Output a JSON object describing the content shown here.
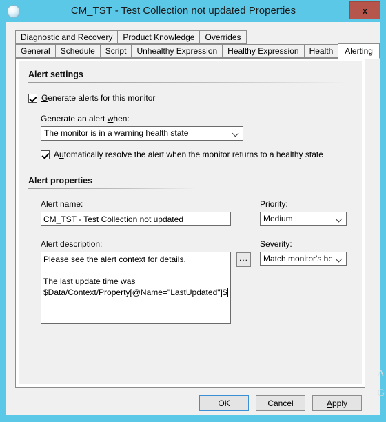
{
  "window": {
    "title": "CM_TST - Test Collection not updated Properties",
    "icon": "monitor-circle-icon",
    "close_label": "x",
    "titlebar_color": "#5cc8e8",
    "close_button_color": "#b5554b"
  },
  "tabs": {
    "row1": [
      {
        "label": "Diagnostic and Recovery",
        "active": false
      },
      {
        "label": "Product Knowledge",
        "active": false
      },
      {
        "label": "Overrides",
        "active": false
      }
    ],
    "row2": [
      {
        "label": "General",
        "active": false
      },
      {
        "label": "Schedule",
        "active": false
      },
      {
        "label": "Script",
        "active": false
      },
      {
        "label": "Unhealthy Expression",
        "active": false
      },
      {
        "label": "Healthy Expression",
        "active": false
      },
      {
        "label": "Health",
        "active": false
      },
      {
        "label": "Alerting",
        "active": true
      }
    ]
  },
  "alert_settings": {
    "section_title": "Alert settings",
    "generate_alerts_checkbox": {
      "label_pre": "G",
      "label_post": "enerate alerts for this monitor",
      "checked": true
    },
    "generate_when_label_pre": "Generate an alert ",
    "generate_when_label_accel": "w",
    "generate_when_label_post": "hen:",
    "generate_when_value": "The monitor is in a warning health state",
    "auto_resolve_checkbox": {
      "label_pre": "A",
      "label_accel": "u",
      "label_post": "tomatically resolve the alert when the monitor returns to a healthy state",
      "checked": true
    }
  },
  "alert_properties": {
    "section_title": "Alert properties",
    "alert_name_label_pre": "Alert na",
    "alert_name_label_accel": "m",
    "alert_name_label_post": "e:",
    "alert_name_value": "CM_TST - Test Collection not updated",
    "alert_description_label_pre": "Alert ",
    "alert_description_label_accel": "d",
    "alert_description_label_post": "escription:",
    "alert_description_value": "Please see the alert context for details.\n\nThe last update time was $Data/Context/Property[@Name=\"LastUpdated\"]$",
    "browse_button_label": "...",
    "priority_label_pre": "Pri",
    "priority_label_accel": "o",
    "priority_label_post": "rity:",
    "priority_value": "Medium",
    "severity_label_pre": "",
    "severity_label_accel": "S",
    "severity_label_post": "everity:",
    "severity_value": "Match monitor's health"
  },
  "footer": {
    "ok_label": "OK",
    "cancel_label": "Cancel",
    "apply_label_accel": "A",
    "apply_label_post": "pply"
  },
  "watermark": {
    "line1": "A",
    "line2": "G"
  }
}
